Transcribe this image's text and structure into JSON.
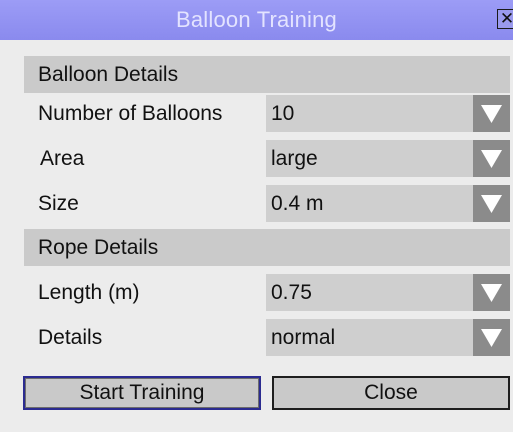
{
  "window": {
    "title": "Balloon Training",
    "close_glyph": "✕"
  },
  "balloon_section": {
    "header": "Balloon Details",
    "rows": [
      {
        "label": "Number of Balloons",
        "value": "10"
      },
      {
        "label": "Area",
        "value": "large"
      },
      {
        "label": "Size",
        "value": "0.4 m"
      }
    ]
  },
  "rope_section": {
    "header": "Rope Details",
    "rows": [
      {
        "label": "Length (m)",
        "value": "0.75"
      },
      {
        "label": "Details",
        "value": "normal"
      }
    ]
  },
  "buttons": {
    "start": "Start Training",
    "close": "Close"
  },
  "colors": {
    "titlebar": "#9c9cf6",
    "section": "#cacaca",
    "arrow": "#8b8b8b",
    "focus_border": "#2b2b90"
  }
}
